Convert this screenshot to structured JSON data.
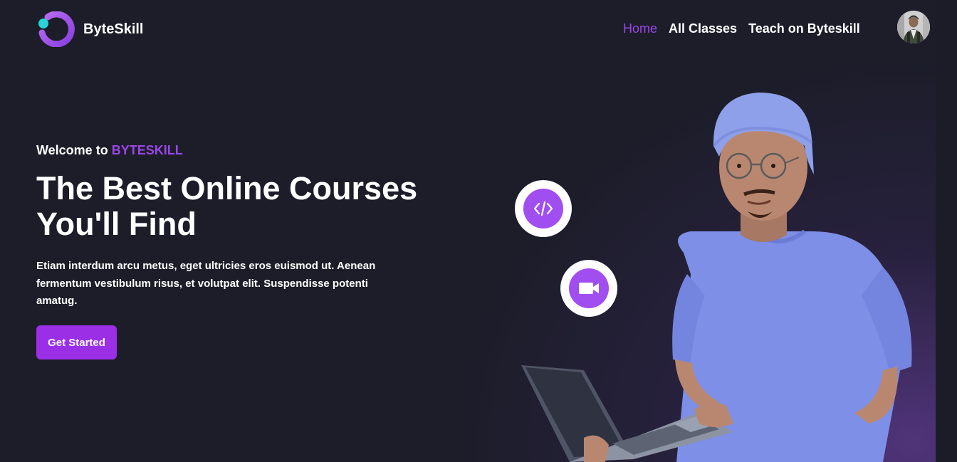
{
  "nav": {
    "brand": "ByteSkill",
    "links": [
      {
        "label": "Home",
        "active": true
      },
      {
        "label": "All Classes",
        "active": false
      },
      {
        "label": "Teach on Byteskill",
        "active": false
      }
    ]
  },
  "hero": {
    "welcome_prefix": "Welcome to ",
    "welcome_brand": "BYTESKILL",
    "headline_line1": "The Best Online Courses",
    "headline_line2": "You'll Find",
    "description": "Etiam interdum arcu metus, eget ultricies eros euismod ut. Aenean fermentum vestibulum risus, et volutpat elit. Suspendisse potenti amatug.",
    "cta_label": "Get Started"
  },
  "icons": {
    "logo": "byteskill-logo-icon",
    "code": "code-icon",
    "video": "video-camera-icon"
  },
  "colors": {
    "background": "#1c1d29",
    "accent": "#9b46e8",
    "button": "#9b2fe6",
    "badge": "#a14ef0"
  }
}
